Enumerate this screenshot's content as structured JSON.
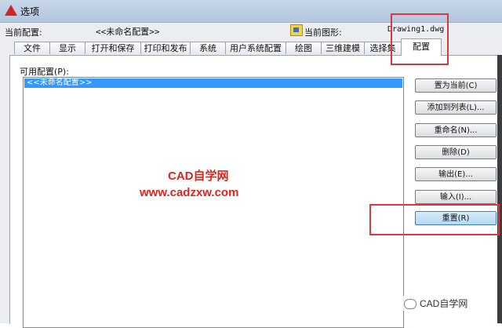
{
  "window": {
    "title": "选项"
  },
  "header": {
    "current_profile_label": "当前配置:",
    "current_profile_value": "<<未命名配置>>",
    "current_drawing_label": "当前图形:",
    "current_drawing_value": "Drawing1.dwg"
  },
  "tabs": [
    {
      "label": "文件"
    },
    {
      "label": "显示"
    },
    {
      "label": "打开和保存"
    },
    {
      "label": "打印和发布"
    },
    {
      "label": "系统"
    },
    {
      "label": "用户系统配置"
    },
    {
      "label": "绘图"
    },
    {
      "label": "三维建模"
    },
    {
      "label": "选择集"
    },
    {
      "label": "配置",
      "active": true
    }
  ],
  "profiles": {
    "label": "可用配置(P):",
    "items": [
      "<<未命名配置>>"
    ],
    "selected": "<<未命名配置>>"
  },
  "buttons": {
    "set_current": "置为当前(C)",
    "add_to_list": "添加到列表(L)...",
    "rename": "重命名(N)...",
    "delete": "删除(D)",
    "export": "输出(E)...",
    "import": "输入(I)...",
    "reset": "重置(R)"
  },
  "watermark": {
    "title": "CAD自学网",
    "url": "www.cadzxw.com",
    "wechat": "CAD自学网"
  },
  "colors": {
    "selection": "#3399ff",
    "highlight_box": "#d8393d",
    "watermark": "#e0241d"
  }
}
